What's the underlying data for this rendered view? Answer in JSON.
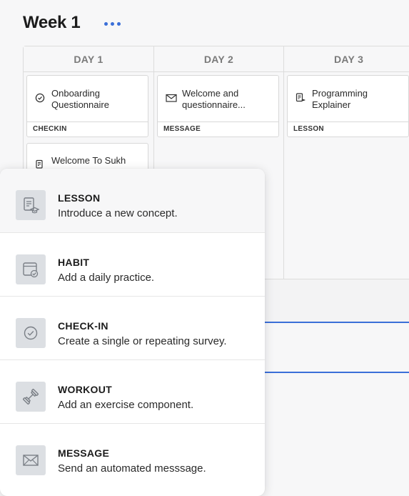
{
  "week": {
    "title": "Week 1",
    "menu_icon": "more-horizontal-icon"
  },
  "accent_color": "#3b6fd8",
  "board": {
    "days": [
      {
        "label": "DAY 1",
        "cards": [
          {
            "title": "Onboarding Questionnaire",
            "tag": "CHECKIN",
            "icon": "checkin-icon"
          },
          {
            "title": "Welcome To Sukh",
            "tag": "",
            "icon": "lesson-icon"
          }
        ]
      },
      {
        "label": "DAY 2",
        "cards": [
          {
            "title": "Welcome and questionnaire...",
            "tag": "MESSAGE",
            "icon": "mail-icon"
          }
        ]
      },
      {
        "label": "DAY 3",
        "cards": [
          {
            "title": "Programming Explainer",
            "tag": "LESSON",
            "icon": "lesson-icon"
          }
        ]
      }
    ]
  },
  "add_menu": {
    "options": [
      {
        "title": "LESSON",
        "description": "Introduce a new concept.",
        "icon": "lesson-icon"
      },
      {
        "title": "HABIT",
        "description": "Add a daily practice.",
        "icon": "habit-icon"
      },
      {
        "title": "CHECK-IN",
        "description": "Create a single or repeating survey.",
        "icon": "checkin-icon"
      },
      {
        "title": "WORKOUT",
        "description": "Add an exercise component.",
        "icon": "dumbbell-icon"
      },
      {
        "title": "MESSAGE",
        "description": "Send an automated messsage.",
        "icon": "mail-icon"
      }
    ]
  }
}
